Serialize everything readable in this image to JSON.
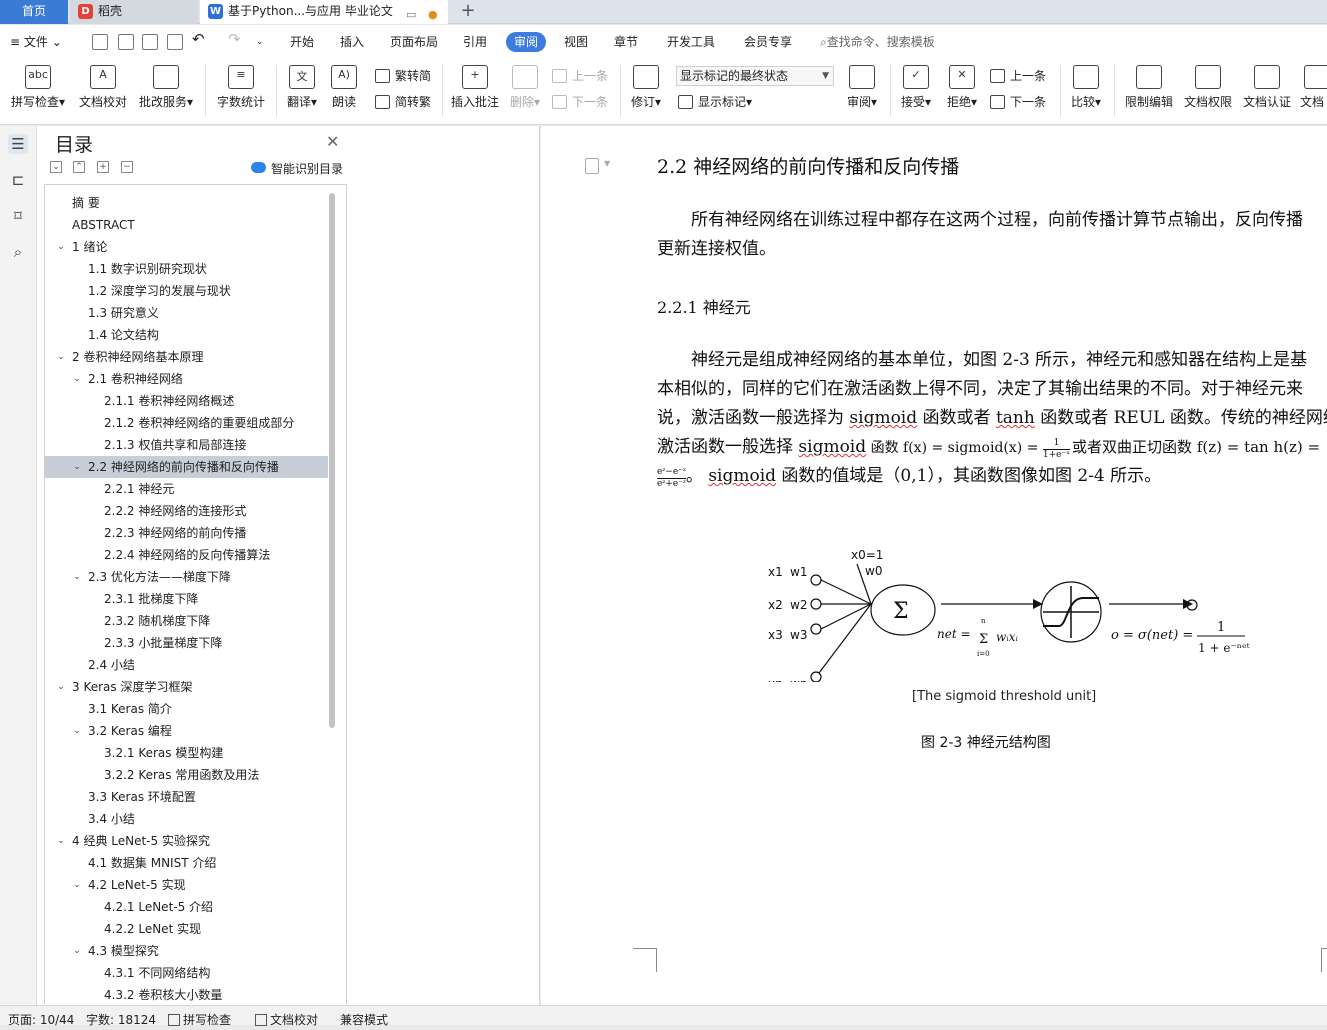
{
  "tabs": {
    "home": "首页",
    "store": "稻壳",
    "document": "基于Python...与应用 毕业论文",
    "add": "+"
  },
  "menu": {
    "file": "文件",
    "items": [
      "开始",
      "插入",
      "页面布局",
      "引用",
      "审阅",
      "视图",
      "章节",
      "开发工具",
      "会员专享"
    ],
    "search": "查找命令、搜索模板"
  },
  "ribbon": {
    "spell_check": "拼写检查",
    "doc_proof": "文档校对",
    "batch_service": "批改服务",
    "word_count": "字数统计",
    "translate": "翻译",
    "read_aloud": "朗读",
    "to_traditional": "繁转简",
    "to_simplified": "简转繁",
    "insert_comment": "插入批注",
    "delete": "删除",
    "prev_comment": "上一条",
    "next_comment": "下一条",
    "revise": "修订",
    "markup_state": "显示标记的最终状态",
    "show_markup": "显示标记",
    "review": "审阅",
    "accept": "接受",
    "reject": "拒绝",
    "prev_change": "上一条",
    "next_change": "下一条",
    "compare": "比较",
    "restrict_edit": "限制编辑",
    "doc_permission": "文档权限",
    "doc_certify": "文档认证",
    "doc_more": "文档"
  },
  "toc": {
    "title": "目录",
    "smart": "智能识别目录",
    "items": [
      {
        "label": "摘  要",
        "level": 0,
        "caret": ""
      },
      {
        "label": "ABSTRACT",
        "level": 0,
        "caret": ""
      },
      {
        "label": "1  绪论",
        "level": 0,
        "caret": "v"
      },
      {
        "label": "1.1  数字识别研究现状",
        "level": 1,
        "caret": ""
      },
      {
        "label": "1.2  深度学习的发展与现状",
        "level": 1,
        "caret": ""
      },
      {
        "label": "1.3  研究意义",
        "level": 1,
        "caret": ""
      },
      {
        "label": "1.4  论文结构",
        "level": 1,
        "caret": ""
      },
      {
        "label": "2  卷积神经网络基本原理",
        "level": 0,
        "caret": "v"
      },
      {
        "label": "2.1  卷积神经网络",
        "level": 1,
        "caret": "v"
      },
      {
        "label": "2.1.1  卷积神经网络概述",
        "level": 2,
        "caret": ""
      },
      {
        "label": "2.1.2  卷积神经网络的重要组成部分",
        "level": 2,
        "caret": ""
      },
      {
        "label": "2.1.3  权值共享和局部连接",
        "level": 2,
        "caret": ""
      },
      {
        "label": "2.2  神经网络的前向传播和反向传播",
        "level": 1,
        "caret": "v",
        "selected": true
      },
      {
        "label": "2.2.1  神经元",
        "level": 2,
        "caret": ""
      },
      {
        "label": "2.2.2  神经网络的连接形式",
        "level": 2,
        "caret": ""
      },
      {
        "label": "2.2.3  神经网络的前向传播",
        "level": 2,
        "caret": ""
      },
      {
        "label": "2.2.4  神经网络的反向传播算法",
        "level": 2,
        "caret": ""
      },
      {
        "label": "2.3  优化方法——梯度下降",
        "level": 1,
        "caret": "v"
      },
      {
        "label": "2.3.1  批梯度下降",
        "level": 2,
        "caret": ""
      },
      {
        "label": "2.3.2  随机梯度下降",
        "level": 2,
        "caret": ""
      },
      {
        "label": "2.3.3  小批量梯度下降",
        "level": 2,
        "caret": ""
      },
      {
        "label": "2.4  小结",
        "level": 1,
        "caret": ""
      },
      {
        "label": "3 Keras 深度学习框架",
        "level": 0,
        "caret": "v"
      },
      {
        "label": "3.1 Keras 简介",
        "level": 1,
        "caret": ""
      },
      {
        "label": "3.2 Keras 编程",
        "level": 1,
        "caret": "v"
      },
      {
        "label": "3.2.1 Keras 模型构建",
        "level": 2,
        "caret": ""
      },
      {
        "label": "3.2.2 Keras 常用函数及用法",
        "level": 2,
        "caret": ""
      },
      {
        "label": "3.3 Keras 环境配置",
        "level": 1,
        "caret": ""
      },
      {
        "label": "3.4  小结",
        "level": 1,
        "caret": ""
      },
      {
        "label": "4  经典 LeNet-5 实验探究",
        "level": 0,
        "caret": "v"
      },
      {
        "label": "4.1  数据集 MNIST 介绍",
        "level": 1,
        "caret": ""
      },
      {
        "label": "4.2 LeNet-5 实现",
        "level": 1,
        "caret": "v"
      },
      {
        "label": "4.2.1 LeNet-5 介绍",
        "level": 2,
        "caret": ""
      },
      {
        "label": "4.2.2 LeNet 实现",
        "level": 2,
        "caret": ""
      },
      {
        "label": "4.3  模型探究",
        "level": 1,
        "caret": "v"
      },
      {
        "label": "4.3.1  不同网络结构",
        "level": 2,
        "caret": ""
      },
      {
        "label": "4.3.2  卷积核大小数量",
        "level": 2,
        "caret": ""
      }
    ]
  },
  "doc": {
    "heading": "2.2  神经网络的前向传播和反向传播",
    "para1_line1": "所有神经网络在训练过程中都存在这两个过程，向前传播计算节点输出，反向传播",
    "para1_line2": "更新连接权值。",
    "subheading": "2.2.1  神经元",
    "p2_l1": "神经元是组成神经网络的基本单位，如图 2-3 所示，神经元和感知器在结构上是基",
    "p2_l2": "本相似的，同样的它们在激活函数上得不同，决定了其输出结果的不同。对于神经元来",
    "p2_l3_a": "说，激活函数一般选择为 ",
    "p2_l3_sig": "sigmoid",
    "p2_l3_b": " 函数或者 ",
    "p2_l3_tanh": "tanh",
    "p2_l3_c": " 函数或者 REUL 函数。传统的神经网络",
    "p2_l4_a": "激活函数一般选择 ",
    "p2_l4_sig": "sigmoid",
    "p2_l4_b": " 函数 f(x) = sigmoid(x) = ",
    "p2_l4_frac_num": "1",
    "p2_l4_frac_den": "1+e⁻ˣ",
    "p2_l4_c": "或者双曲正切函数 f(z) = tan h(z) =",
    "p2_l5_frac_num": "eᶻ−e⁻ᶻ",
    "p2_l5_frac_den": "eᶻ+e⁻ᶻ",
    "p2_l5_a": "。 ",
    "p2_l5_sig": "sigmoid",
    "p2_l5_b": " 函数的值域是（0,1），其函数图像如图 2-4 所示。",
    "figure": {
      "inputs": [
        "x1",
        "x2",
        "x3",
        "xn"
      ],
      "weights": [
        "w1",
        "w2",
        "w3",
        "wn"
      ],
      "bias_input": "x0=1",
      "bias_weight": "w0",
      "sum_symbol": "Σ",
      "net_label": "net =",
      "sum_upper": "n",
      "sum_lower": "i=0",
      "sum_term": "wᵢxᵢ",
      "out_label": "o = σ(net) =",
      "out_num": "1",
      "out_den": "1 + e⁻ⁿᵉᵗ",
      "caption_en": "[The sigmoid threshold unit]",
      "caption": "图 2-3  神经元结构图"
    }
  },
  "status": {
    "page": "页面: 10/44",
    "words": "字数: 18124",
    "spell": "拼写检查",
    "proof": "文档校对",
    "compat": "兼容模式"
  }
}
